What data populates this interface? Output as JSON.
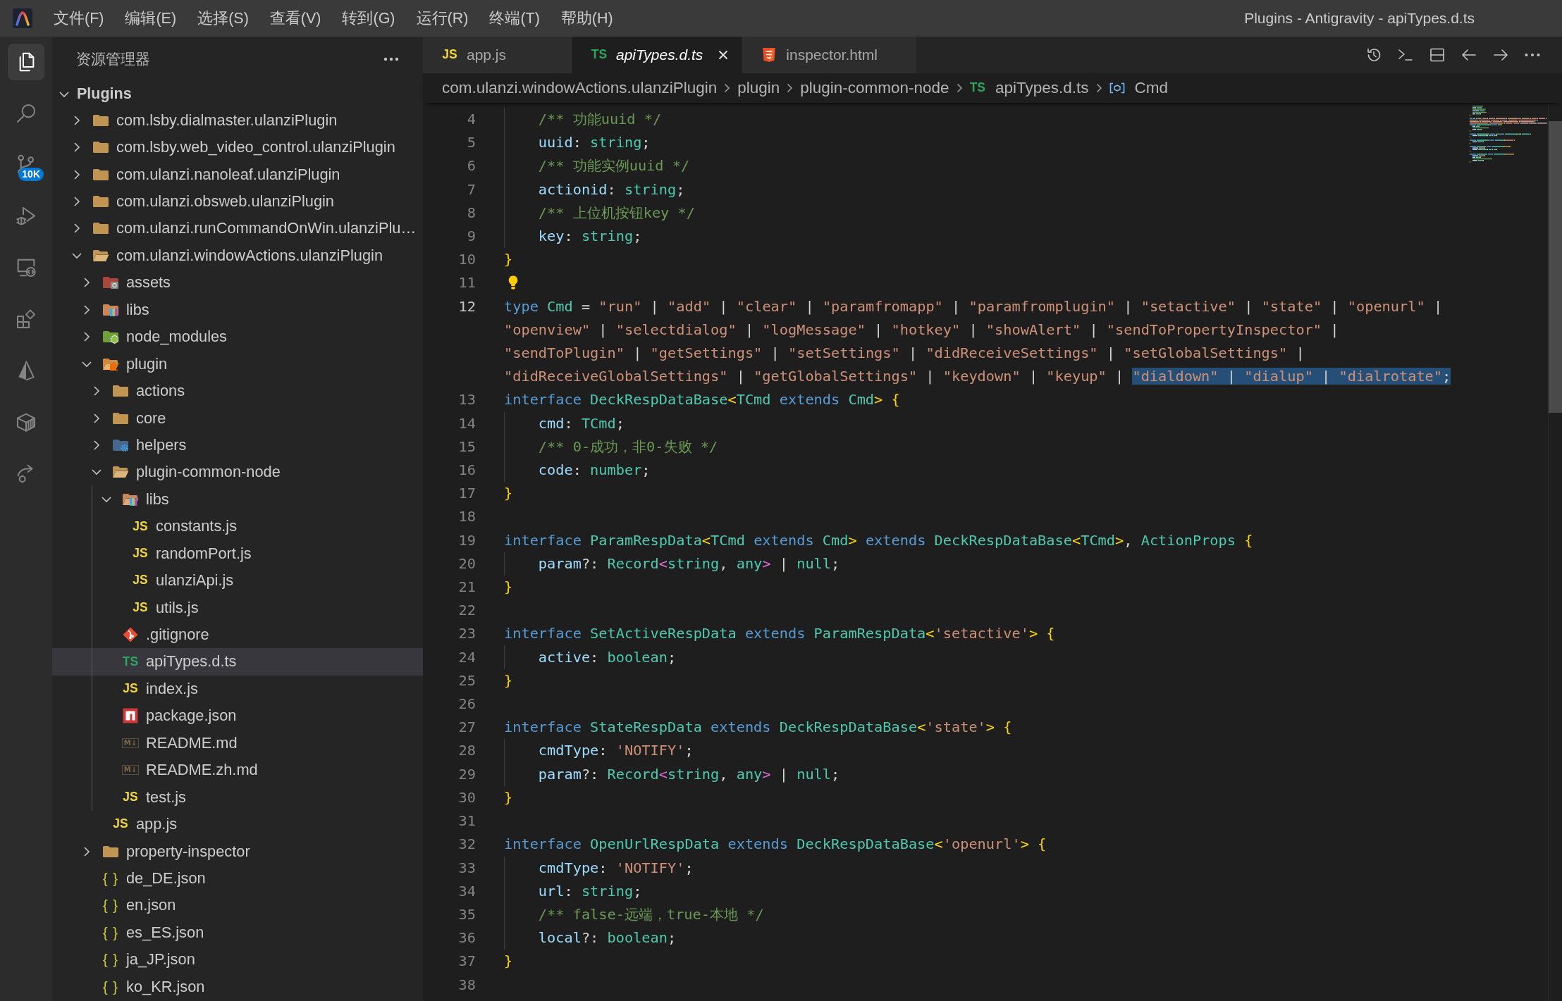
{
  "window": {
    "title": "Plugins - Antigravity - apiTypes.d.ts"
  },
  "menu": [
    "文件(F)",
    "编辑(E)",
    "选择(S)",
    "查看(V)",
    "转到(G)",
    "运行(R)",
    "终端(T)",
    "帮助(H)"
  ],
  "activity_bar": [
    {
      "kind": "files",
      "selected": true
    },
    {
      "kind": "search",
      "selected": false
    },
    {
      "kind": "source-control",
      "selected": false,
      "badge": "10K"
    },
    {
      "kind": "run-debug",
      "selected": false
    },
    {
      "kind": "remote",
      "selected": false
    },
    {
      "kind": "extensions",
      "selected": false
    },
    {
      "kind": "prism",
      "selected": false
    },
    {
      "kind": "package",
      "selected": false
    },
    {
      "kind": "share",
      "selected": false
    }
  ],
  "explorer": {
    "title": "资源管理器",
    "section": {
      "label": "Plugins",
      "expanded": true
    },
    "tree": [
      {
        "label": "com.lsby.dialmaster.ulanziPlugin",
        "kind": "folder",
        "expanded": false,
        "selected": false
      },
      {
        "label": "com.lsby.web_video_control.ulanziPlugin",
        "kind": "folder",
        "expanded": false,
        "selected": false
      },
      {
        "label": "com.ulanzi.nanoleaf.ulanziPlugin",
        "kind": "folder",
        "expanded": false,
        "selected": false
      },
      {
        "label": "com.ulanzi.obsweb.ulanziPlugin",
        "kind": "folder",
        "expanded": false,
        "selected": false
      },
      {
        "label": "com.ulanzi.runCommandOnWin.ulanziPlu…",
        "kind": "folder",
        "expanded": false,
        "selected": false
      },
      {
        "label": "com.ulanzi.windowActions.ulanziPlugin",
        "kind": "folder",
        "expanded": true,
        "selected": false,
        "children": [
          {
            "label": "assets",
            "kind": "folder-assets",
            "expanded": false,
            "selected": false
          },
          {
            "label": "libs",
            "kind": "folder-lib",
            "expanded": false,
            "selected": false
          },
          {
            "label": "node_modules",
            "kind": "folder-node",
            "expanded": false,
            "selected": false
          },
          {
            "label": "plugin",
            "kind": "folder-plugin",
            "expanded": true,
            "selected": false,
            "children": [
              {
                "label": "actions",
                "kind": "folder",
                "expanded": false,
                "selected": false
              },
              {
                "label": "core",
                "kind": "folder",
                "expanded": false,
                "selected": false
              },
              {
                "label": "helpers",
                "kind": "folder-helper",
                "expanded": false,
                "selected": false
              },
              {
                "label": "plugin-common-node",
                "kind": "folder",
                "expanded": true,
                "selected": false,
                "children": [
                  {
                    "label": "libs",
                    "kind": "folder-lib",
                    "expanded": true,
                    "selected": false,
                    "children": [
                      {
                        "label": "constants.js",
                        "kind": "js",
                        "icon_text": "JS",
                        "selected": false
                      },
                      {
                        "label": "randomPort.js",
                        "kind": "js",
                        "icon_text": "JS",
                        "selected": false
                      },
                      {
                        "label": "ulanziApi.js",
                        "kind": "js",
                        "icon_text": "JS",
                        "selected": false
                      },
                      {
                        "label": "utils.js",
                        "kind": "js",
                        "icon_text": "JS",
                        "selected": false
                      }
                    ]
                  },
                  {
                    "label": ".gitignore",
                    "kind": "git",
                    "selected": false
                  },
                  {
                    "label": "apiTypes.d.ts",
                    "kind": "ts",
                    "icon_text": "TS",
                    "selected": true
                  },
                  {
                    "label": "index.js",
                    "kind": "js",
                    "icon_text": "JS",
                    "selected": false
                  },
                  {
                    "label": "package.json",
                    "kind": "npm",
                    "selected": false
                  },
                  {
                    "label": "README.md",
                    "kind": "md",
                    "icon_text": "M↓",
                    "selected": false
                  },
                  {
                    "label": "README.zh.md",
                    "kind": "md",
                    "icon_text": "M↓",
                    "selected": false
                  },
                  {
                    "label": "test.js",
                    "kind": "js",
                    "icon_text": "JS",
                    "selected": false
                  }
                ]
              },
              {
                "label": "app.js",
                "kind": "js",
                "icon_text": "JS",
                "selected": false
              }
            ]
          },
          {
            "label": "property-inspector",
            "kind": "folder",
            "expanded": false,
            "selected": false
          },
          {
            "label": "de_DE.json",
            "kind": "json",
            "icon_text": "{ }",
            "selected": false
          },
          {
            "label": "en.json",
            "kind": "json",
            "icon_text": "{ }",
            "selected": false
          },
          {
            "label": "es_ES.json",
            "kind": "json",
            "icon_text": "{ }",
            "selected": false
          },
          {
            "label": "ja_JP.json",
            "kind": "json",
            "icon_text": "{ }",
            "selected": false
          },
          {
            "label": "ko_KR.json",
            "kind": "json",
            "icon_text": "{ }",
            "selected": false
          }
        ]
      }
    ]
  },
  "editor": {
    "tabs": [
      {
        "label": "app.js",
        "kind": "js",
        "icon_text": "JS",
        "selected": false,
        "preview": false
      },
      {
        "label": "apiTypes.d.ts",
        "kind": "ts",
        "icon_text": "TS",
        "selected": true,
        "preview": true
      },
      {
        "label": "inspector.html",
        "kind": "html",
        "selected": false,
        "preview": false
      }
    ],
    "breadcrumb": [
      {
        "label": "com.ulanzi.windowActions.ulanziPlugin",
        "kind": "folder"
      },
      {
        "label": "plugin",
        "kind": "folder"
      },
      {
        "label": "plugin-common-node",
        "kind": "folder"
      },
      {
        "label": "apiTypes.d.ts",
        "kind": "ts",
        "icon_text": "TS"
      },
      {
        "label": "Cmd",
        "kind": "symbol"
      }
    ],
    "lines": [
      {
        "children": [
          {
            "number": "4",
            "tokens": [
              {
                "kind": "comment",
                "text": "/** 功能uuid */"
              }
            ]
          },
          {
            "number": "5",
            "tokens": [
              {
                "kind": "property",
                "text": "uuid"
              },
              {
                "kind": "plain",
                "text": ": "
              },
              {
                "kind": "type",
                "text": "string"
              },
              {
                "kind": "plain",
                "text": ";"
              }
            ]
          },
          {
            "number": "6",
            "tokens": [
              {
                "kind": "comment",
                "text": "/** 功能实例uuid */"
              }
            ]
          },
          {
            "number": "7",
            "tokens": [
              {
                "kind": "property",
                "text": "actionid"
              },
              {
                "kind": "plain",
                "text": ": "
              },
              {
                "kind": "type",
                "text": "string"
              },
              {
                "kind": "plain",
                "text": ";"
              }
            ]
          },
          {
            "number": "8",
            "tokens": [
              {
                "kind": "comment",
                "text": "/** 上位机按钮key */"
              }
            ]
          },
          {
            "number": "9",
            "tokens": [
              {
                "kind": "property",
                "text": "key"
              },
              {
                "kind": "plain",
                "text": ": "
              },
              {
                "kind": "type",
                "text": "string"
              },
              {
                "kind": "plain",
                "text": ";"
              }
            ]
          }
        ]
      },
      {
        "number": "10",
        "tokens": [
          {
            "kind": "bracket",
            "text": "}"
          }
        ]
      },
      {
        "number": "11",
        "lightbulb": true
      },
      {
        "number": "12",
        "current": true,
        "tokens": [
          {
            "kind": "keyword",
            "text": "type "
          },
          {
            "kind": "type",
            "text": "Cmd"
          },
          {
            "kind": "plain",
            "text": " = "
          },
          {
            "kind": "string",
            "text": "\"run\""
          },
          {
            "kind": "plain",
            "text": " | "
          },
          {
            "kind": "string",
            "text": "\"add\""
          },
          {
            "kind": "plain",
            "text": " | "
          },
          {
            "kind": "string",
            "text": "\"clear\""
          },
          {
            "kind": "plain",
            "text": " | "
          },
          {
            "kind": "string",
            "text": "\"paramfromapp\""
          },
          {
            "kind": "plain",
            "text": " | "
          },
          {
            "kind": "string",
            "text": "\"paramfromplugin\""
          },
          {
            "kind": "plain",
            "text": " | "
          },
          {
            "kind": "string",
            "text": "\"setactive\""
          },
          {
            "kind": "plain",
            "text": " | "
          },
          {
            "kind": "string",
            "text": "\"state\""
          },
          {
            "kind": "plain",
            "text": " | "
          },
          {
            "kind": "string",
            "text": "\"openurl\""
          },
          {
            "kind": "plain",
            "text": " | "
          },
          {
            "kind": "string",
            "text": "\"openview\""
          },
          {
            "kind": "plain",
            "text": " | "
          },
          {
            "kind": "string",
            "text": "\"selectdialog\""
          },
          {
            "kind": "plain",
            "text": " | "
          },
          {
            "kind": "string",
            "text": "\"logMessage\""
          },
          {
            "kind": "plain",
            "text": " | "
          },
          {
            "kind": "string",
            "text": "\"hotkey\""
          },
          {
            "kind": "plain",
            "text": " | "
          },
          {
            "kind": "string",
            "text": "\"showAlert\""
          },
          {
            "kind": "plain",
            "text": " | "
          },
          {
            "kind": "string",
            "text": "\"sendToPropertyInspector\""
          },
          {
            "kind": "plain",
            "text": " | "
          },
          {
            "kind": "string",
            "text": "\"sendToPlugin\""
          },
          {
            "kind": "plain",
            "text": " | "
          },
          {
            "kind": "string",
            "text": "\"getSettings\""
          },
          {
            "kind": "plain",
            "text": " | "
          },
          {
            "kind": "string",
            "text": "\"setSettings\""
          },
          {
            "kind": "plain",
            "text": " | "
          },
          {
            "kind": "string",
            "text": "\"didReceiveSettings\""
          },
          {
            "kind": "plain",
            "text": " | "
          },
          {
            "kind": "string",
            "text": "\"setGlobalSettings\""
          },
          {
            "kind": "plain",
            "text": " | "
          },
          {
            "kind": "string",
            "text": "\"didReceiveGlobalSettings\""
          },
          {
            "kind": "plain",
            "text": " | "
          },
          {
            "kind": "string",
            "text": "\"getGlobalSettings\""
          },
          {
            "kind": "plain",
            "text": " | "
          },
          {
            "kind": "string",
            "text": "\"keydown\""
          },
          {
            "kind": "plain",
            "text": " | "
          },
          {
            "kind": "string",
            "text": "\"keyup\""
          },
          {
            "kind": "plain",
            "text": " | "
          },
          {
            "kind": "string",
            "text": "\"dialdown\"",
            "selected": true
          },
          {
            "kind": "plain",
            "text": " | ",
            "selected": true
          },
          {
            "kind": "string",
            "text": "\"dialup\"",
            "selected": true
          },
          {
            "kind": "plain",
            "text": " | ",
            "selected": true
          },
          {
            "kind": "string",
            "text": "\"dialrotate\"",
            "selected": true
          },
          {
            "kind": "plain",
            "text": ";",
            "selected": true
          }
        ]
      },
      {
        "number": "13",
        "tokens": [
          {
            "kind": "keyword",
            "text": "interface "
          },
          {
            "kind": "type",
            "text": "DeckRespDataBase"
          },
          {
            "kind": "bracket",
            "text": "<"
          },
          {
            "kind": "type",
            "text": "TCmd "
          },
          {
            "kind": "keyword",
            "text": "extends "
          },
          {
            "kind": "type",
            "text": "Cmd"
          },
          {
            "kind": "bracket",
            "text": ">"
          },
          {
            "kind": "bracket",
            "text": " {"
          }
        ],
        "children": [
          {
            "number": "14",
            "tokens": [
              {
                "kind": "property",
                "text": "cmd"
              },
              {
                "kind": "plain",
                "text": ": "
              },
              {
                "kind": "type",
                "text": "TCmd"
              },
              {
                "kind": "plain",
                "text": ";"
              }
            ]
          },
          {
            "number": "15",
            "tokens": [
              {
                "kind": "comment",
                "text": "/** 0-成功，非0-失败 */"
              }
            ]
          },
          {
            "number": "16",
            "tokens": [
              {
                "kind": "property",
                "text": "code"
              },
              {
                "kind": "plain",
                "text": ": "
              },
              {
                "kind": "type",
                "text": "number"
              },
              {
                "kind": "plain",
                "text": ";"
              }
            ]
          }
        ]
      },
      {
        "number": "17",
        "tokens": [
          {
            "kind": "bracket",
            "text": "}"
          }
        ]
      },
      {
        "number": "18"
      },
      {
        "number": "19",
        "tokens": [
          {
            "kind": "keyword",
            "text": "interface "
          },
          {
            "kind": "type",
            "text": "ParamRespData"
          },
          {
            "kind": "bracket",
            "text": "<"
          },
          {
            "kind": "type",
            "text": "TCmd "
          },
          {
            "kind": "keyword",
            "text": "extends "
          },
          {
            "kind": "type",
            "text": "Cmd"
          },
          {
            "kind": "bracket",
            "text": ">"
          },
          {
            "kind": "keyword",
            "text": " extends "
          },
          {
            "kind": "type",
            "text": "DeckRespDataBase"
          },
          {
            "kind": "bracket",
            "text": "<"
          },
          {
            "kind": "type",
            "text": "TCmd"
          },
          {
            "kind": "bracket",
            "text": ">"
          },
          {
            "kind": "plain",
            "text": ", "
          },
          {
            "kind": "type",
            "text": "ActionProps"
          },
          {
            "kind": "bracket",
            "text": " {"
          }
        ],
        "children": [
          {
            "number": "20",
            "tokens": [
              {
                "kind": "property",
                "text": "param"
              },
              {
                "kind": "plain",
                "text": "?: "
              },
              {
                "kind": "type",
                "text": "Record"
              },
              {
                "kind": "bracket-nested",
                "text": "<"
              },
              {
                "kind": "type",
                "text": "string"
              },
              {
                "kind": "plain",
                "text": ", "
              },
              {
                "kind": "type",
                "text": "any"
              },
              {
                "kind": "bracket-nested",
                "text": ">"
              },
              {
                "kind": "plain",
                "text": " | "
              },
              {
                "kind": "type",
                "text": "null"
              },
              {
                "kind": "plain",
                "text": ";"
              }
            ]
          }
        ]
      },
      {
        "number": "21",
        "tokens": [
          {
            "kind": "bracket",
            "text": "}"
          }
        ]
      },
      {
        "number": "22"
      },
      {
        "number": "23",
        "tokens": [
          {
            "kind": "keyword",
            "text": "interface "
          },
          {
            "kind": "type",
            "text": "SetActiveRespData "
          },
          {
            "kind": "keyword",
            "text": "extends "
          },
          {
            "kind": "type",
            "text": "ParamRespData"
          },
          {
            "kind": "bracket",
            "text": "<"
          },
          {
            "kind": "string",
            "text": "'setactive'"
          },
          {
            "kind": "bracket",
            "text": ">"
          },
          {
            "kind": "bracket",
            "text": " {"
          }
        ],
        "children": [
          {
            "number": "24",
            "tokens": [
              {
                "kind": "property",
                "text": "active"
              },
              {
                "kind": "plain",
                "text": ": "
              },
              {
                "kind": "type",
                "text": "boolean"
              },
              {
                "kind": "plain",
                "text": ";"
              }
            ]
          }
        ]
      },
      {
        "number": "25",
        "tokens": [
          {
            "kind": "bracket",
            "text": "}"
          }
        ]
      },
      {
        "number": "26"
      },
      {
        "number": "27",
        "tokens": [
          {
            "kind": "keyword",
            "text": "interface "
          },
          {
            "kind": "type",
            "text": "StateRespData "
          },
          {
            "kind": "keyword",
            "text": "extends "
          },
          {
            "kind": "type",
            "text": "DeckRespDataBase"
          },
          {
            "kind": "bracket",
            "text": "<"
          },
          {
            "kind": "string",
            "text": "'state'"
          },
          {
            "kind": "bracket",
            "text": ">"
          },
          {
            "kind": "bracket",
            "text": " {"
          }
        ],
        "children": [
          {
            "number": "28",
            "tokens": [
              {
                "kind": "property",
                "text": "cmdType"
              },
              {
                "kind": "plain",
                "text": ": "
              },
              {
                "kind": "string",
                "text": "'NOTIFY'"
              },
              {
                "kind": "plain",
                "text": ";"
              }
            ]
          },
          {
            "number": "29",
            "tokens": [
              {
                "kind": "property",
                "text": "param"
              },
              {
                "kind": "plain",
                "text": "?: "
              },
              {
                "kind": "type",
                "text": "Record"
              },
              {
                "kind": "bracket-nested",
                "text": "<"
              },
              {
                "kind": "type",
                "text": "string"
              },
              {
                "kind": "plain",
                "text": ", "
              },
              {
                "kind": "type",
                "text": "any"
              },
              {
                "kind": "bracket-nested",
                "text": ">"
              },
              {
                "kind": "plain",
                "text": " | "
              },
              {
                "kind": "type",
                "text": "null"
              },
              {
                "kind": "plain",
                "text": ";"
              }
            ]
          }
        ]
      },
      {
        "number": "30",
        "tokens": [
          {
            "kind": "bracket",
            "text": "}"
          }
        ]
      },
      {
        "number": "31"
      },
      {
        "number": "32",
        "tokens": [
          {
            "kind": "keyword",
            "text": "interface "
          },
          {
            "kind": "type",
            "text": "OpenUrlRespData "
          },
          {
            "kind": "keyword",
            "text": "extends "
          },
          {
            "kind": "type",
            "text": "DeckRespDataBase"
          },
          {
            "kind": "bracket",
            "text": "<"
          },
          {
            "kind": "string",
            "text": "'openurl'"
          },
          {
            "kind": "bracket",
            "text": ">"
          },
          {
            "kind": "bracket",
            "text": " {"
          }
        ],
        "children": [
          {
            "number": "33",
            "tokens": [
              {
                "kind": "property",
                "text": "cmdType"
              },
              {
                "kind": "plain",
                "text": ": "
              },
              {
                "kind": "string",
                "text": "'NOTIFY'"
              },
              {
                "kind": "plain",
                "text": ";"
              }
            ]
          },
          {
            "number": "34",
            "tokens": [
              {
                "kind": "property",
                "text": "url"
              },
              {
                "kind": "plain",
                "text": ": "
              },
              {
                "kind": "type",
                "text": "string"
              },
              {
                "kind": "plain",
                "text": ";"
              }
            ]
          },
          {
            "number": "35",
            "tokens": [
              {
                "kind": "comment",
                "text": "/** false-远端，true-本地 */"
              }
            ]
          },
          {
            "number": "36",
            "tokens": [
              {
                "kind": "property",
                "text": "local"
              },
              {
                "kind": "plain",
                "text": "?: "
              },
              {
                "kind": "type",
                "text": "boolean"
              },
              {
                "kind": "plain",
                "text": ";"
              }
            ]
          }
        ]
      },
      {
        "number": "37",
        "tokens": [
          {
            "kind": "bracket",
            "text": "}"
          }
        ]
      },
      {
        "number": "38"
      }
    ]
  }
}
